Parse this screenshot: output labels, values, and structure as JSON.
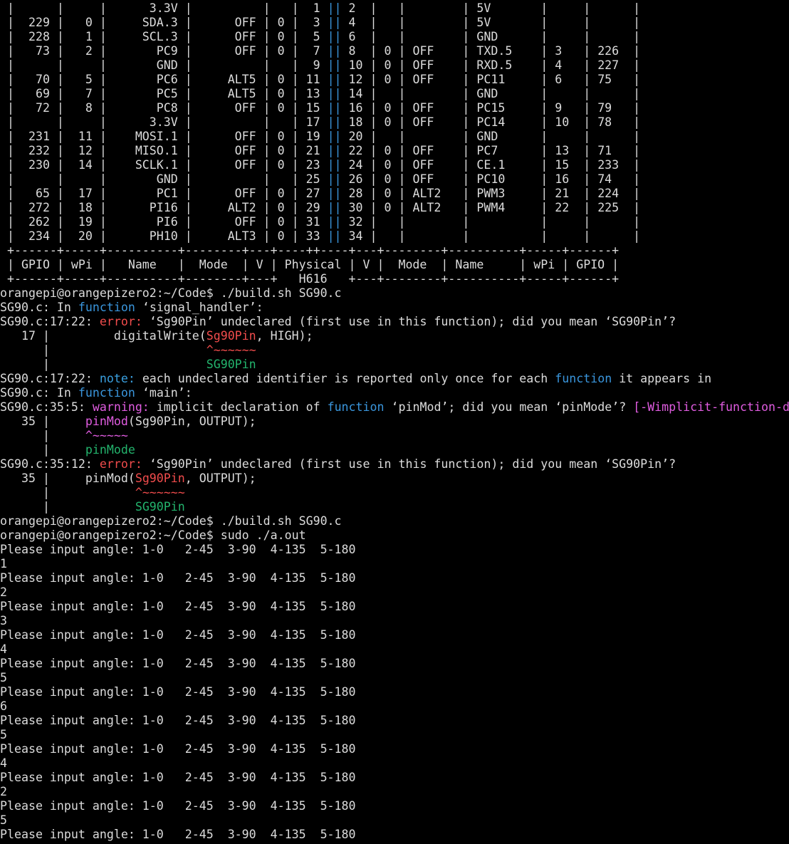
{
  "colors": {
    "background": "#000000",
    "foreground": "#dcdcdc",
    "cyan": "#3a96dd",
    "error": "#f14c4c",
    "warning": "#e05ce0",
    "note": "#3aa0e0",
    "fixit": "#23b46d"
  },
  "terminal": {
    "lines": [
      {
        "segs": [
          {
            "t": " |      |     |      3.3V |          |   |  1 "
          },
          {
            "t": "||",
            "c": "cyan"
          },
          {
            "t": " 2  |   |        | 5V       |     |      |"
          }
        ]
      },
      {
        "segs": [
          {
            "t": " |  229 |   0 |     SDA.3 |      OFF | 0 |  3 "
          },
          {
            "t": "||",
            "c": "cyan"
          },
          {
            "t": " 4  |   |        | 5V       |     |      |"
          }
        ]
      },
      {
        "segs": [
          {
            "t": " |  228 |   1 |     SCL.3 |      OFF | 0 |  5 "
          },
          {
            "t": "||",
            "c": "cyan"
          },
          {
            "t": " 6  |   |        | GND      |     |      |"
          }
        ]
      },
      {
        "segs": [
          {
            "t": " |   73 |   2 |       PC9 |      OFF | 0 |  7 "
          },
          {
            "t": "||",
            "c": "cyan"
          },
          {
            "t": " 8  | 0 | OFF    | TXD.5    | 3   | 226  |"
          }
        ]
      },
      {
        "segs": [
          {
            "t": " |      |     |       GND |          |   |  9 "
          },
          {
            "t": "||",
            "c": "cyan"
          },
          {
            "t": " 10 | 0 | OFF    | RXD.5    | 4   | 227  |"
          }
        ]
      },
      {
        "segs": [
          {
            "t": " |   70 |   5 |       PC6 |     ALT5 | 0 | 11 "
          },
          {
            "t": "||",
            "c": "cyan"
          },
          {
            "t": " 12 | 0 | OFF    | PC11     | 6   | 75   |"
          }
        ]
      },
      {
        "segs": [
          {
            "t": " |   69 |   7 |       PC5 |     ALT5 | 0 | 13 "
          },
          {
            "t": "||",
            "c": "cyan"
          },
          {
            "t": " 14 |   |        | GND      |     |      |"
          }
        ]
      },
      {
        "segs": [
          {
            "t": " |   72 |   8 |       PC8 |      OFF | 0 | 15 "
          },
          {
            "t": "||",
            "c": "cyan"
          },
          {
            "t": " 16 | 0 | OFF    | PC15     | 9   | 79   |"
          }
        ]
      },
      {
        "segs": [
          {
            "t": " |      |     |      3.3V |          |   | 17 "
          },
          {
            "t": "||",
            "c": "cyan"
          },
          {
            "t": " 18 | 0 | OFF    | PC14     | 10  | 78   |"
          }
        ]
      },
      {
        "segs": [
          {
            "t": " |  231 |  11 |    MOSI.1 |      OFF | 0 | 19 "
          },
          {
            "t": "||",
            "c": "cyan"
          },
          {
            "t": " 20 |   |        | GND      |     |      |"
          }
        ]
      },
      {
        "segs": [
          {
            "t": " |  232 |  12 |    MISO.1 |      OFF | 0 | 21 "
          },
          {
            "t": "||",
            "c": "cyan"
          },
          {
            "t": " 22 | 0 | OFF    | PC7      | 13  | 71   |"
          }
        ]
      },
      {
        "segs": [
          {
            "t": " |  230 |  14 |    SCLK.1 |      OFF | 0 | 23 "
          },
          {
            "t": "||",
            "c": "cyan"
          },
          {
            "t": " 24 | 0 | OFF    | CE.1     | 15  | 233  |"
          }
        ]
      },
      {
        "segs": [
          {
            "t": " |      |     |       GND |          |   | 25 "
          },
          {
            "t": "||",
            "c": "cyan"
          },
          {
            "t": " 26 | 0 | OFF    | PC10     | 16  | 74   |"
          }
        ]
      },
      {
        "segs": [
          {
            "t": " |   65 |  17 |       PC1 |      OFF | 0 | 27 "
          },
          {
            "t": "||",
            "c": "cyan"
          },
          {
            "t": " 28 | 0 | ALT2   | PWM3     | 21  | 224  |"
          }
        ]
      },
      {
        "segs": [
          {
            "t": " |  272 |  18 |      PI16 |     ALT2 | 0 | 29 "
          },
          {
            "t": "||",
            "c": "cyan"
          },
          {
            "t": " 30 | 0 | ALT2   | PWM4     | 22  | 225  |"
          }
        ]
      },
      {
        "segs": [
          {
            "t": " |  262 |  19 |       PI6 |      OFF | 0 | 31 "
          },
          {
            "t": "||",
            "c": "cyan"
          },
          {
            "t": " 32 |   |        |          |     |      |"
          }
        ]
      },
      {
        "segs": [
          {
            "t": " |  234 |  20 |      PH10 |     ALT3 | 0 | 33 "
          },
          {
            "t": "||",
            "c": "cyan"
          },
          {
            "t": " 34 |   |        |          |     |      |"
          }
        ]
      },
      {
        "segs": [
          {
            "t": " +------+-----+----------+--------+---+----++----+---+--------+----------+-----+------+"
          }
        ]
      },
      {
        "segs": [
          {
            "t": " | GPIO | wPi |   Name   |  Mode  | V | Physical | V |  Mode  | Name     | wPi | GPIO |"
          }
        ]
      },
      {
        "segs": [
          {
            "t": " +------+-----+----------+--------+---+   H616   +---+--------+----------+-----+------+"
          }
        ]
      },
      {
        "segs": [
          {
            "t": "orangepi@orangepizero2:~/Code$ ./build.sh SG90.c"
          }
        ]
      },
      {
        "segs": [
          {
            "t": "SG90.c: In "
          },
          {
            "t": "function",
            "c": "kw"
          },
          {
            "t": " ‘signal_handler’:"
          }
        ]
      },
      {
        "segs": [
          {
            "t": "SG90.c:17:22: "
          },
          {
            "t": "error:",
            "c": "err"
          },
          {
            "t": " ‘Sg90Pin’ undeclared (first use in this function); did you mean ‘SG90Pin’?"
          }
        ]
      },
      {
        "segs": [
          {
            "t": "   17 |         digitalWrite("
          },
          {
            "t": "Sg90Pin",
            "c": "err"
          },
          {
            "t": ", HIGH);"
          }
        ]
      },
      {
        "segs": [
          {
            "t": "      |                      "
          },
          {
            "t": "^~~~~~~",
            "c": "err"
          }
        ]
      },
      {
        "segs": [
          {
            "t": "      |                      "
          },
          {
            "t": "SG90Pin",
            "c": "fix"
          }
        ]
      },
      {
        "segs": [
          {
            "t": "SG90.c:17:22: "
          },
          {
            "t": "note:",
            "c": "note"
          },
          {
            "t": " each undeclared identifier is reported only once for each "
          },
          {
            "t": "function",
            "c": "kw"
          },
          {
            "t": " it appears in"
          }
        ]
      },
      {
        "segs": [
          {
            "t": "SG90.c: In "
          },
          {
            "t": "function",
            "c": "kw"
          },
          {
            "t": " ‘main’:"
          }
        ]
      },
      {
        "segs": [
          {
            "t": "SG90.c:35:5: "
          },
          {
            "t": "warning:",
            "c": "warn"
          },
          {
            "t": " implicit declaration of "
          },
          {
            "t": "function",
            "c": "kw"
          },
          {
            "t": " ‘pinMod’; did you mean ‘pinMode’? "
          },
          {
            "t": "[-Wimplicit-function-d",
            "c": "warn"
          }
        ]
      },
      {
        "segs": [
          {
            "t": "   35 |     "
          },
          {
            "t": "pinMod",
            "c": "warn"
          },
          {
            "t": "(Sg90Pin, OUTPUT);"
          }
        ]
      },
      {
        "segs": [
          {
            "t": "      |     "
          },
          {
            "t": "^~~~~~",
            "c": "warn"
          }
        ]
      },
      {
        "segs": [
          {
            "t": "      |     "
          },
          {
            "t": "pinMode",
            "c": "fix"
          }
        ]
      },
      {
        "segs": [
          {
            "t": "SG90.c:35:12: "
          },
          {
            "t": "error:",
            "c": "err"
          },
          {
            "t": " ‘Sg90Pin’ undeclared (first use in this function); did you mean ‘SG90Pin’?"
          }
        ]
      },
      {
        "segs": [
          {
            "t": "   35 |     pinMod("
          },
          {
            "t": "Sg90Pin",
            "c": "err"
          },
          {
            "t": ", OUTPUT);"
          }
        ]
      },
      {
        "segs": [
          {
            "t": "      |            "
          },
          {
            "t": "^~~~~~~",
            "c": "err"
          }
        ]
      },
      {
        "segs": [
          {
            "t": "      |            "
          },
          {
            "t": "SG90Pin",
            "c": "fix"
          }
        ]
      },
      {
        "segs": [
          {
            "t": "orangepi@orangepizero2:~/Code$ ./build.sh SG90.c"
          }
        ]
      },
      {
        "segs": [
          {
            "t": "orangepi@orangepizero2:~/Code$ sudo ./a.out"
          }
        ]
      },
      {
        "segs": [
          {
            "t": "Please input angle: 1-0   2-45  3-90  4-135  5-180"
          }
        ]
      },
      {
        "segs": [
          {
            "t": "1"
          }
        ]
      },
      {
        "segs": [
          {
            "t": "Please input angle: 1-0   2-45  3-90  4-135  5-180"
          }
        ]
      },
      {
        "segs": [
          {
            "t": "2"
          }
        ]
      },
      {
        "segs": [
          {
            "t": "Please input angle: 1-0   2-45  3-90  4-135  5-180"
          }
        ]
      },
      {
        "segs": [
          {
            "t": "3"
          }
        ]
      },
      {
        "segs": [
          {
            "t": "Please input angle: 1-0   2-45  3-90  4-135  5-180"
          }
        ]
      },
      {
        "segs": [
          {
            "t": "4"
          }
        ]
      },
      {
        "segs": [
          {
            "t": "Please input angle: 1-0   2-45  3-90  4-135  5-180"
          }
        ]
      },
      {
        "segs": [
          {
            "t": "5"
          }
        ]
      },
      {
        "segs": [
          {
            "t": "Please input angle: 1-0   2-45  3-90  4-135  5-180"
          }
        ]
      },
      {
        "segs": [
          {
            "t": "6"
          }
        ]
      },
      {
        "segs": [
          {
            "t": "Please input angle: 1-0   2-45  3-90  4-135  5-180"
          }
        ]
      },
      {
        "segs": [
          {
            "t": "5"
          }
        ]
      },
      {
        "segs": [
          {
            "t": "Please input angle: 1-0   2-45  3-90  4-135  5-180"
          }
        ]
      },
      {
        "segs": [
          {
            "t": "4"
          }
        ]
      },
      {
        "segs": [
          {
            "t": "Please input angle: 1-0   2-45  3-90  4-135  5-180"
          }
        ]
      },
      {
        "segs": [
          {
            "t": "2"
          }
        ]
      },
      {
        "segs": [
          {
            "t": "Please input angle: 1-0   2-45  3-90  4-135  5-180"
          }
        ]
      },
      {
        "segs": [
          {
            "t": "5"
          }
        ]
      },
      {
        "segs": [
          {
            "t": "Please input angle: 1-0   2-45  3-90  4-135  5-180"
          }
        ]
      }
    ]
  }
}
